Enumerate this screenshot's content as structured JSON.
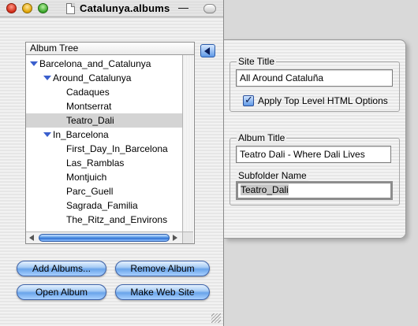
{
  "window": {
    "title": "Catalunya.albums",
    "title_dash": "—"
  },
  "tree": {
    "header": "Album Tree",
    "items": [
      {
        "label": "Barcelona_and_Catalunya"
      },
      {
        "label": "Around_Catalunya"
      },
      {
        "label": "Cadaques"
      },
      {
        "label": "Montserrat"
      },
      {
        "label": "Teatro_Dali",
        "selected": true
      },
      {
        "label": "In_Barcelona"
      },
      {
        "label": "First_Day_In_Barcelona"
      },
      {
        "label": "Las_Ramblas"
      },
      {
        "label": "Montjuich"
      },
      {
        "label": "Parc_Guell"
      },
      {
        "label": "Sagrada_Familia"
      },
      {
        "label": "The_Ritz_and_Environs"
      }
    ]
  },
  "buttons": {
    "add_albums": "Add Albums...",
    "remove_album": "Remove Album",
    "open_album": "Open Album",
    "make_web_site": "Make Web Site"
  },
  "drawer": {
    "site_title_label": "Site Title",
    "site_title_value": "All Around Cataluña",
    "apply_option_label": "Apply Top Level HTML Options",
    "apply_option_checked": true,
    "album_title_label": "Album Title",
    "album_title_value": "Teatro Dali - Where Dali Lives",
    "subfolder_label": "Subfolder Name",
    "subfolder_value": "Teatro_Dali"
  },
  "colors": {
    "accent": "#3a5fcd",
    "selection": "#d4d4d4"
  }
}
